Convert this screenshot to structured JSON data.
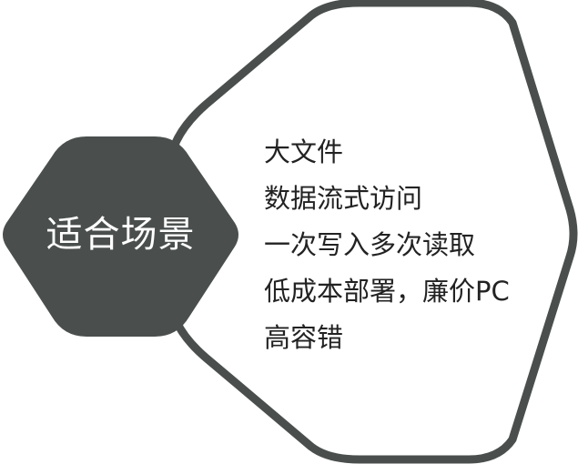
{
  "title": "适合场景",
  "items": [
    "大文件",
    "数据流式访问",
    "一次写入多次读取",
    "低成本部署，廉价PC",
    "高容错"
  ],
  "colors": {
    "hex_fill": "#4a4f4e",
    "outline": "#4a4f4e",
    "title_text": "#ffffff",
    "item_text": "#222222",
    "background": "#ffffff"
  }
}
